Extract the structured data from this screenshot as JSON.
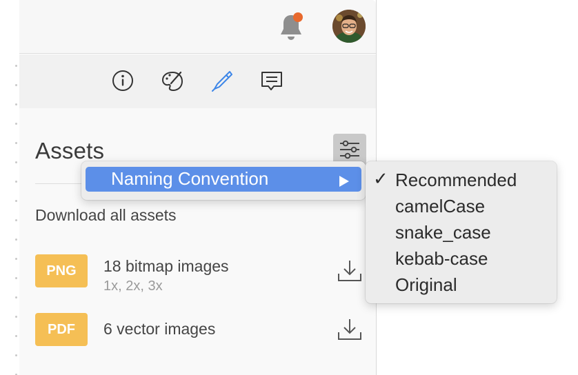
{
  "topbar": {
    "notifications_icon": "bell-icon",
    "notification_badge_color": "#e8692d",
    "avatar_icon": "user-avatar"
  },
  "inspector_tabs": [
    {
      "name": "info",
      "icon": "info-icon",
      "active": false
    },
    {
      "name": "styles",
      "icon": "palette-icon",
      "active": false
    },
    {
      "name": "assets",
      "icon": "pen-icon",
      "active": true
    },
    {
      "name": "comments",
      "icon": "comment-icon",
      "active": false
    }
  ],
  "assets": {
    "title": "Assets",
    "download_all": "Download all assets",
    "items": [
      {
        "badge": "PNG",
        "title": "18 bitmap images",
        "subtitle": "1x, 2x, 3x"
      },
      {
        "badge": "PDF",
        "title": "6 vector images",
        "subtitle": ""
      }
    ]
  },
  "menu": {
    "item_label": "Naming Convention"
  },
  "submenu": {
    "check_mark": "✓",
    "options": [
      {
        "label": "Recommended",
        "checked": true
      },
      {
        "label": "camelCase",
        "checked": false
      },
      {
        "label": "snake_case",
        "checked": false
      },
      {
        "label": "kebab-case",
        "checked": false
      },
      {
        "label": "Original",
        "checked": false
      }
    ]
  },
  "colors": {
    "accent": "#5c8fe8",
    "badge": "#f5bf55",
    "active_tab": "#3d86e8"
  }
}
